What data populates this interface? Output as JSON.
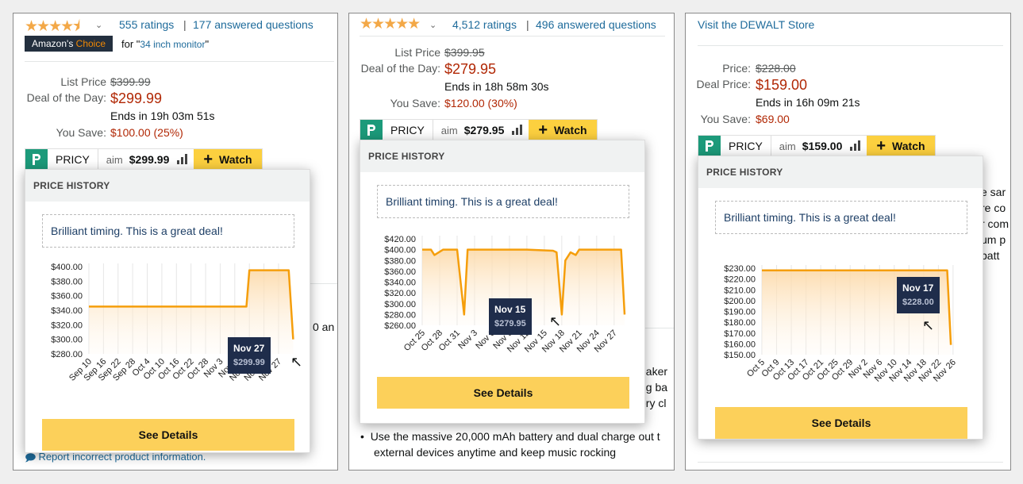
{
  "panels": [
    {
      "rating": {
        "stars": "★★★★⯨",
        "ratings": "555 ratings",
        "sep": "|",
        "answered": "177 answered questions"
      },
      "choice": {
        "badge_a": "Amazon's ",
        "badge_b": "Choice",
        "for_text": "for \"",
        "query": "34 inch monitor",
        "close_q": "\""
      },
      "price_labels": {
        "list": "List Price",
        "deal": "Deal of the Day:",
        "save": "You Save:"
      },
      "list_price": "$399.99",
      "deal_price": "$299.99",
      "ends": "Ends in 19h 03m 51s",
      "you_save": "$100.00 (25%)",
      "pricy": {
        "brand": "PRICY",
        "aim": "aim",
        "aim_value": "$299.99",
        "watch": "Watch"
      },
      "popup": {
        "header": "PRICE HISTORY",
        "message": "Brilliant timing. This is a great deal!",
        "button": "See Details"
      },
      "tooltip": {
        "date": "Nov 27",
        "value": "$299.99"
      },
      "side_text": {
        "t1": "0 an",
        "footer_icon": "comment-icon",
        "footer": "Report incorrect product information."
      }
    },
    {
      "rating": {
        "stars": "★★★★★",
        "ratings": "4,512 ratings",
        "sep": "|",
        "answered": "496 answered questions"
      },
      "price_labels": {
        "list": "List Price",
        "deal": "Deal of the Day:",
        "save": "You Save:"
      },
      "list_price": "$399.95",
      "deal_price": "$279.95",
      "ends": "Ends in 18h 58m 30s",
      "you_save": "$120.00 (30%)",
      "pricy": {
        "brand": "PRICY",
        "aim": "aim",
        "aim_value": "$279.95",
        "watch": "Watch"
      },
      "popup": {
        "header": "PRICE HISTORY",
        "message": "Brilliant timing. This is a great deal!",
        "button": "See Details"
      },
      "tooltip": {
        "date": "Nov 15",
        "value": "$279.95"
      },
      "side_text": {
        "s1": "eaker",
        "s2": "ng ba",
        "s3": "ery cl",
        "bullet": "Use the massive 20,000 mAh battery and dual charge out t",
        "bullet2": "external devices anytime and keep music rocking"
      }
    },
    {
      "store": "Visit the DEWALT Store",
      "price_labels": {
        "list": "Price:",
        "deal": "Deal Price:",
        "save": "You Save:"
      },
      "list_price": "$228.00",
      "deal_price": "$159.00",
      "ends": "Ends in 16h 09m 21s",
      "you_save": "$69.00",
      "pricy": {
        "brand": "PRICY",
        "aim": "aim",
        "aim_value": "$159.00",
        "watch": "Watch"
      },
      "popup": {
        "header": "PRICE HISTORY",
        "message": "Brilliant timing. This is a great deal!",
        "button": "See Details"
      },
      "tooltip": {
        "date": "Nov 17",
        "value": "$228.00"
      },
      "side_text": {
        "s1": "e sar",
        "s2": "re co",
        "s3": "r com",
        "s4": "um p",
        "s5": "batt"
      }
    }
  ],
  "chart_data": [
    {
      "type": "area",
      "color": "#f59e0b",
      "x_ticks": [
        "Sep 10",
        "Sep 16",
        "Sep 22",
        "Sep 28",
        "Oct 4",
        "Oct 10",
        "Oct 16",
        "Oct 22",
        "Oct 28",
        "Nov 3",
        "Nov 9",
        "Nov 15",
        "Nov 21",
        "Nov 27"
      ],
      "y_ticks": [
        "$400.00",
        "$380.00",
        "$360.00",
        "$340.00",
        "$320.00",
        "$300.00",
        "$280.00"
      ],
      "ylim": [
        280,
        400
      ],
      "x": [
        0,
        10.8,
        11.0,
        13.7,
        14.0
      ],
      "y": [
        345,
        345,
        395,
        395,
        299.99
      ]
    },
    {
      "type": "area",
      "color": "#f59e0b",
      "x_ticks": [
        "Oct 25",
        "Oct 28",
        "Oct 31",
        "Nov 3",
        "Nov 6",
        "Nov 9",
        "Nov 12",
        "Nov 15",
        "Nov 18",
        "Nov 21",
        "Nov 24",
        "Nov 27"
      ],
      "y_ticks": [
        "$420.00",
        "$400.00",
        "$380.00",
        "$360.00",
        "$340.00",
        "$320.00",
        "$300.00",
        "$280.00",
        "$260.00"
      ],
      "ylim": [
        260,
        420
      ],
      "x": [
        0,
        0.5,
        0.7,
        1.2,
        1.6,
        2.0,
        2.4,
        2.6,
        2.9,
        4.0,
        5.0,
        6.0,
        7.5,
        7.7,
        8.0,
        8.2,
        8.5,
        8.8,
        9.0,
        10.0,
        11.0,
        11.4,
        11.6
      ],
      "y": [
        400,
        400,
        390,
        400,
        400,
        400,
        280,
        400,
        400,
        400,
        400,
        400,
        398,
        395,
        280,
        380,
        395,
        390,
        400,
        400,
        400,
        400,
        280
      ]
    },
    {
      "type": "area",
      "color": "#f59e0b",
      "x_ticks": [
        "Oct 5",
        "Oct 9",
        "Oct 13",
        "Oct 17",
        "Oct 21",
        "Oct 25",
        "Oct 29",
        "Nov 2",
        "Nov 6",
        "Nov 10",
        "Nov 14",
        "Nov 18",
        "Nov 22",
        "Nov 26"
      ],
      "y_ticks": [
        "$230.00",
        "$220.00",
        "$210.00",
        "$200.00",
        "$190.00",
        "$180.00",
        "$170.00",
        "$160.00",
        "$150.00"
      ],
      "ylim": [
        150,
        230
      ],
      "x": [
        0,
        12.6,
        12.85
      ],
      "y": [
        228,
        228,
        159
      ]
    }
  ]
}
